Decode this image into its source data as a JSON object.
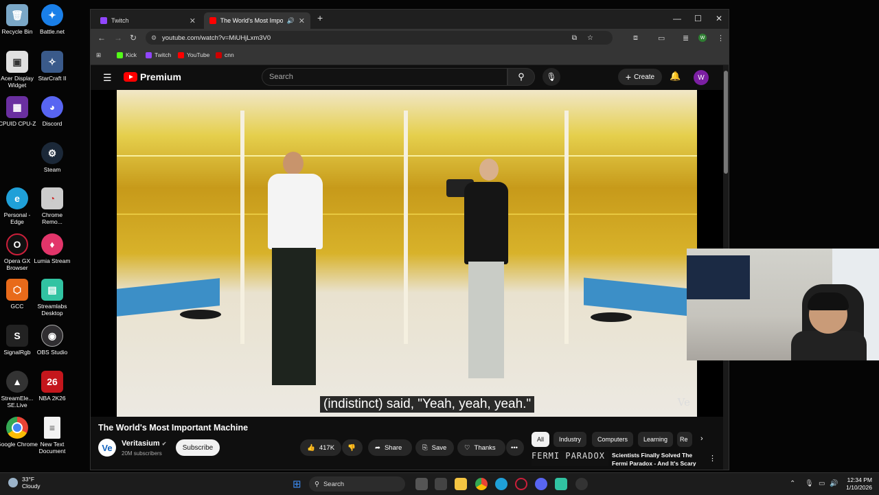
{
  "desktop": {
    "icons": [
      {
        "label": "Recycle Bin",
        "color": "#7aa7c7"
      },
      {
        "label": "Battle.net",
        "color": "#1a7fe8"
      },
      {
        "label": "Acer Display Widget",
        "color": "#e0e0e0"
      },
      {
        "label": "StarCraft II",
        "color": "#3a5a8a"
      },
      {
        "label": "CPUID CPU-Z",
        "color": "#6a2fa0"
      },
      {
        "label": "Discord",
        "color": "#5865f2"
      },
      {
        "label": "Steam",
        "color": "#1b2838"
      },
      {
        "label": "Personal - Edge",
        "color": "#1fa0d8"
      },
      {
        "label": "Chrome Remo...",
        "color": "#cccccc"
      },
      {
        "label": "Opera GX Browser",
        "color": "#cc1f3a"
      },
      {
        "label": "Lumia Stream",
        "color": "#e2356a"
      },
      {
        "label": "GCC",
        "color": "#e86a1a"
      },
      {
        "label": "Streamlabs Desktop",
        "color": "#31c3a2"
      },
      {
        "label": "SignalRgb",
        "color": "#222222"
      },
      {
        "label": "OBS Studio",
        "color": "#302e31"
      },
      {
        "label": "StreamEle... SE.Live",
        "color": "#333333"
      },
      {
        "label": "NBA 2K26",
        "color": "#c4161c"
      },
      {
        "label": "Google Chrome",
        "color": "#4285f4"
      },
      {
        "label": "New Text Document",
        "color": "#f2f2f2"
      }
    ]
  },
  "browser": {
    "tabs": [
      {
        "label": "Twitch",
        "color": "#9146ff"
      },
      {
        "label": "The World's Most Importan",
        "color": "#ff0000"
      }
    ],
    "url": "youtube.com/watch?v=MiUHjLxm3V0",
    "bookmarks": [
      {
        "label": "Kick",
        "color": "#53fc18"
      },
      {
        "label": "Twitch",
        "color": "#9146ff"
      },
      {
        "label": "YouTube",
        "color": "#ff0000"
      },
      {
        "label": "cnn",
        "color": "#cc0000"
      }
    ]
  },
  "youtube": {
    "logo_text": "Premium",
    "search_placeholder": "Search",
    "create_label": "Create",
    "avatar_letter": "W",
    "caption": "(indistinct) said, \"Yeah, yeah, yeah.\"",
    "watermark": "Ve",
    "video_title": "The World's Most Important Machine",
    "channel": {
      "name": "Veritasium",
      "subs": "20M subscribers",
      "avatar": "Ve"
    },
    "subscribe_label": "Subscribe",
    "likes": "417K",
    "share_label": "Share",
    "save_label": "Save",
    "thanks_label": "Thanks",
    "chips": [
      "All",
      "Industry",
      "Computers",
      "Learning",
      "Re"
    ],
    "recommendation": {
      "thumb_text": "FERMI PARADOX",
      "title": "Scientists Finally Solved The Fermi Paradox - And It's Scary"
    }
  },
  "taskbar": {
    "weather_temp": "33°F",
    "weather_desc": "Cloudy",
    "search_label": "Search",
    "time": "12:34 PM",
    "date": "1/10/2026"
  }
}
